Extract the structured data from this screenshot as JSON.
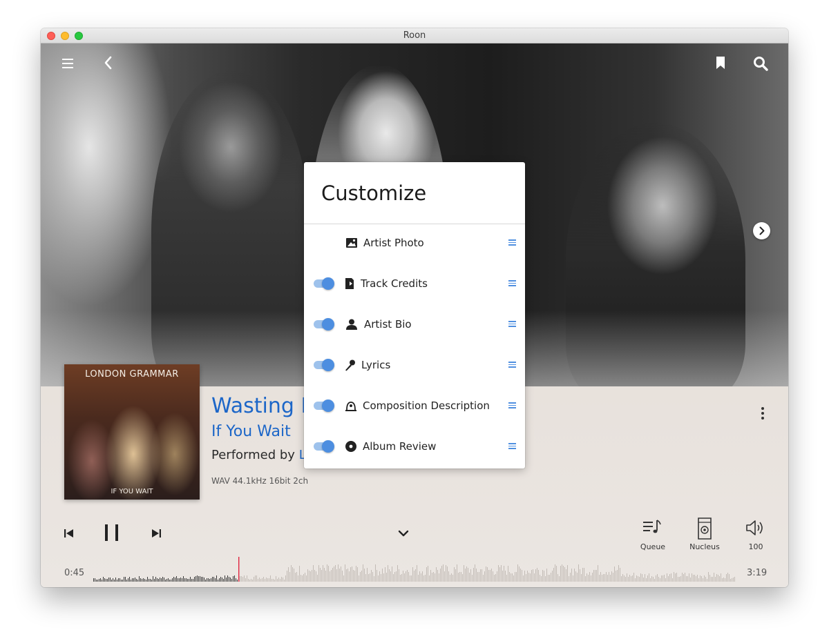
{
  "window": {
    "title": "Roon"
  },
  "header": {
    "menu_icon": "hamburger-menu-icon",
    "back_icon": "chevron-left-icon",
    "bookmark_icon": "bookmark-icon",
    "search_icon": "search-icon",
    "next_photo_icon": "chevron-right-icon"
  },
  "customize": {
    "title": "Customize",
    "items": [
      {
        "label": "Artist Photo",
        "icon": "image-icon",
        "toggle": false
      },
      {
        "label": "Track Credits",
        "icon": "credits-icon",
        "toggle": true
      },
      {
        "label": "Artist Bio",
        "icon": "person-icon",
        "toggle": true
      },
      {
        "label": "Lyrics",
        "icon": "microphone-icon",
        "toggle": true
      },
      {
        "label": "Composition Description",
        "icon": "composition-icon",
        "toggle": true
      },
      {
        "label": "Album Review",
        "icon": "record-icon",
        "toggle": true
      }
    ]
  },
  "now_playing": {
    "album_art": {
      "band": "LONDON GRAMMAR",
      "title": "IF YOU WAIT"
    },
    "track_title": "Wasting M",
    "album": "If You Wait",
    "performed_prefix": "Performed by ",
    "artist": "Lo",
    "format": "WAV 44.1kHz 16bit 2ch"
  },
  "transport": {
    "elapsed": "0:45",
    "duration": "3:19",
    "progress": 0.226,
    "queue_label": "Queue",
    "zone_label": "Nucleus",
    "volume_label": "100"
  },
  "colors": {
    "accent": "#1c66c8",
    "toggle_on": "#4d8ee0",
    "playhead": "#e0243f"
  }
}
